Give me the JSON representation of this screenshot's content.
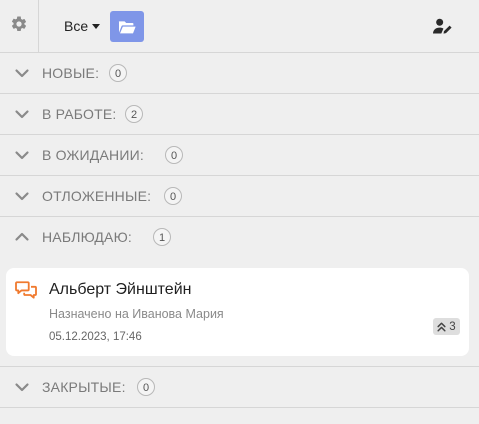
{
  "toolbar": {
    "filter_label": "Все",
    "icons": {
      "settings": "gear-icon",
      "folder": "folder-open-icon",
      "assign": "user-edit-icon"
    },
    "folder_color": "#7f96e8"
  },
  "sections": [
    {
      "label": "НОВЫЕ:",
      "count": "0",
      "expanded": false
    },
    {
      "label": "В РАБОТЕ:",
      "count": "2",
      "expanded": false
    },
    {
      "label": "В ОЖИДАНИИ:",
      "count": "0",
      "expanded": false
    },
    {
      "label": "ОТЛОЖЕННЫЕ:",
      "count": "0",
      "expanded": false
    },
    {
      "label": "НАБЛЮДАЮ:",
      "count": "1",
      "expanded": true
    },
    {
      "label": "ЗАКРЫТЫЕ:",
      "count": "0",
      "expanded": false
    }
  ],
  "ticket": {
    "title": "Альберт Эйнштейн",
    "assigned": "Назначено на Иванова Мария",
    "datetime": "05.12.2023, 17:46",
    "priority": "3",
    "icon": "chat-bubbles-icon",
    "icon_color": "#f07a2f"
  }
}
